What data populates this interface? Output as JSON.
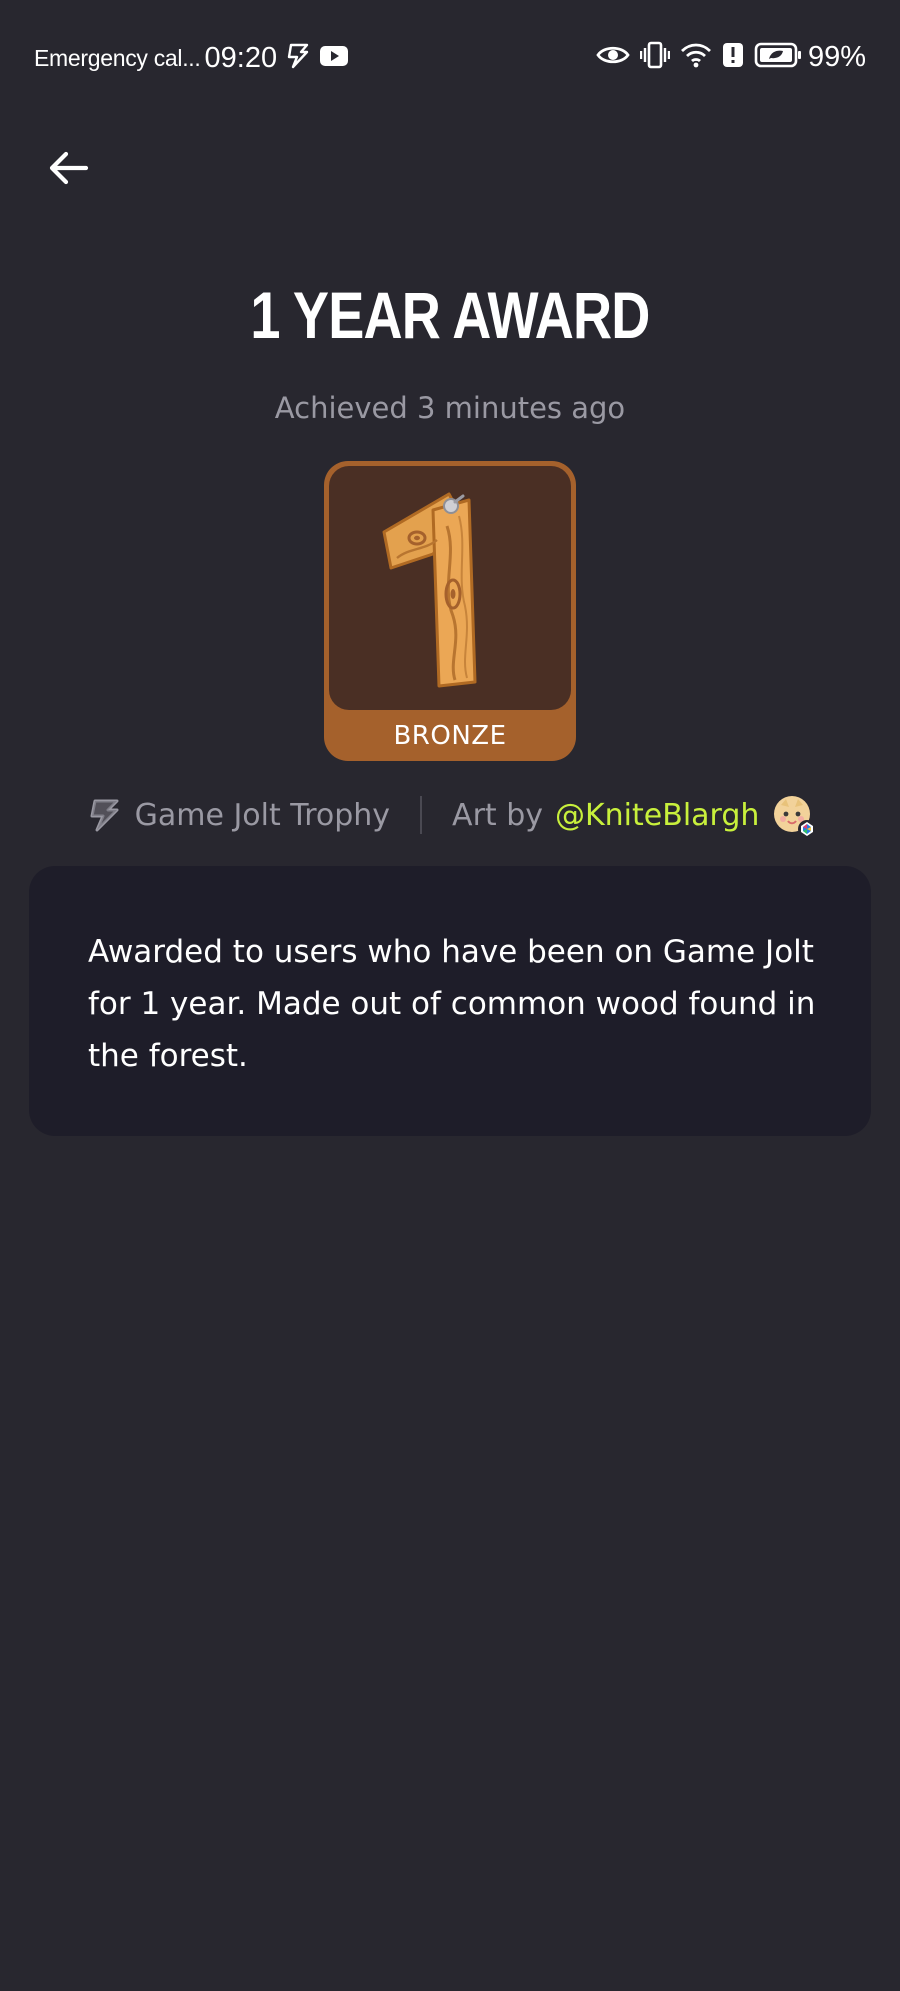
{
  "status_bar": {
    "carrier": "Emergency cal...",
    "time": "09:20",
    "battery_percent": "99%",
    "icons_left": [
      "gamejolt-bolt-icon",
      "youtube-icon"
    ],
    "icons_right": [
      "eye-icon",
      "vibrate-icon",
      "wifi-icon",
      "alert-icon",
      "battery-icon"
    ]
  },
  "header": {
    "back_icon": "arrow-left-icon"
  },
  "trophy": {
    "title": "1 YEAR AWARD",
    "achieved": "Achieved 3 minutes ago",
    "tier": "BRONZE",
    "tier_color": "#a5612c"
  },
  "meta": {
    "source_icon": "gamejolt-bolt-icon",
    "source_label": "Game Jolt Trophy",
    "art_by_label": "Art by",
    "artist_handle": "@KniteBlargh",
    "artist_color": "#c8f03c"
  },
  "description": {
    "text": "Awarded to users who have been on Game Jolt for 1 year. Made out of common wood found in the forest."
  }
}
